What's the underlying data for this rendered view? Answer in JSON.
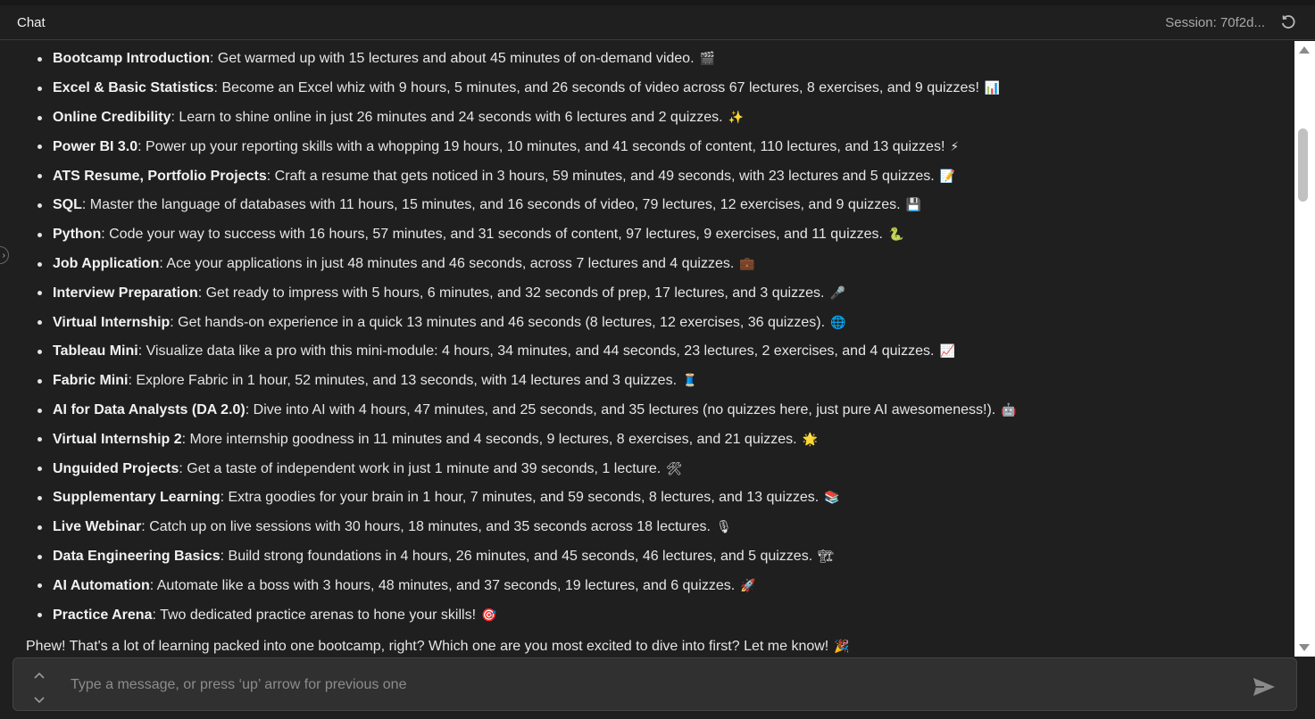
{
  "header": {
    "title": "Chat",
    "session": "Session: 70f2d..."
  },
  "messages": {
    "items": [
      {
        "name": "Bootcamp Introduction",
        "text": ": Get warmed up with 15 lectures and about 45 minutes of on-demand video.",
        "emoji": "🎬"
      },
      {
        "name": "Excel & Basic Statistics",
        "text": ": Become an Excel whiz with 9 hours, 5 minutes, and 26 seconds of video across 67 lectures, 8 exercises, and 9 quizzes!",
        "emoji": "📊"
      },
      {
        "name": "Online Credibility",
        "text": ": Learn to shine online in just 26 minutes and 24 seconds with 6 lectures and 2 quizzes.",
        "emoji": "✨"
      },
      {
        "name": "Power BI 3.0",
        "text": ": Power up your reporting skills with a whopping 19 hours, 10 minutes, and 41 seconds of content, 110 lectures, and 13 quizzes!",
        "emoji": "⚡"
      },
      {
        "name": "ATS Resume, Portfolio Projects",
        "text": ": Craft a resume that gets noticed in 3 hours, 59 minutes, and 49 seconds, with 23 lectures and 5 quizzes.",
        "emoji": "📝"
      },
      {
        "name": "SQL",
        "text": ": Master the language of databases with 11 hours, 15 minutes, and 16 seconds of video, 79 lectures, 12 exercises, and 9 quizzes.",
        "emoji": "💾"
      },
      {
        "name": "Python",
        "text": ": Code your way to success with 16 hours, 57 minutes, and 31 seconds of content, 97 lectures, 9 exercises, and 11 quizzes.",
        "emoji": "🐍"
      },
      {
        "name": "Job Application",
        "text": ": Ace your applications in just 48 minutes and 46 seconds, across 7 lectures and 4 quizzes.",
        "emoji": "💼"
      },
      {
        "name": "Interview Preparation",
        "text": ": Get ready to impress with 5 hours, 6 minutes, and 32 seconds of prep, 17 lectures, and 3 quizzes.",
        "emoji": "🎤"
      },
      {
        "name": "Virtual Internship",
        "text": ": Get hands-on experience in a quick 13 minutes and 46 seconds (8 lectures, 12 exercises, 36 quizzes).",
        "emoji": "🌐"
      },
      {
        "name": "Tableau Mini",
        "text": ": Visualize data like a pro with this mini-module: 4 hours, 34 minutes, and 44 seconds, 23 lectures, 2 exercises, and 4 quizzes.",
        "emoji": "📈"
      },
      {
        "name": "Fabric Mini",
        "text": ": Explore Fabric in 1 hour, 52 minutes, and 13 seconds, with 14 lectures and 3 quizzes.",
        "emoji": "🧵"
      },
      {
        "name": "AI for Data Analysts (DA 2.0)",
        "text": ": Dive into AI with 4 hours, 47 minutes, and 25 seconds, and 35 lectures (no quizzes here, just pure AI awesomeness!).",
        "emoji": "🤖"
      },
      {
        "name": "Virtual Internship 2",
        "text": ": More internship goodness in 11 minutes and 4 seconds, 9 lectures, 8 exercises, and 21 quizzes.",
        "emoji": "🌟"
      },
      {
        "name": "Unguided Projects",
        "text": ": Get a taste of independent work in just 1 minute and 39 seconds, 1 lecture.",
        "emoji": "🛠"
      },
      {
        "name": "Supplementary Learning",
        "text": ": Extra goodies for your brain in 1 hour, 7 minutes, and 59 seconds, 8 lectures, and 13 quizzes.",
        "emoji": "📚"
      },
      {
        "name": "Live Webinar",
        "text": ": Catch up on live sessions with 30 hours, 18 minutes, and 35 seconds across 18 lectures.",
        "emoji": "🎙"
      },
      {
        "name": "Data Engineering Basics",
        "text": ": Build strong foundations in 4 hours, 26 minutes, and 45 seconds, 46 lectures, and 5 quizzes.",
        "emoji": "🏗"
      },
      {
        "name": "AI Automation",
        "text": ": Automate like a boss with 3 hours, 48 minutes, and 37 seconds, 19 lectures, and 6 quizzes.",
        "emoji": "🚀"
      },
      {
        "name": "Practice Arena",
        "text": ": Two dedicated practice arenas to hone your skills!",
        "emoji": "🎯"
      }
    ],
    "closing": "Phew! That's a lot of learning packed into one bootcamp, right? Which one are you most excited to dive into first? Let me know!",
    "closing_emoji": "🎉"
  },
  "input": {
    "placeholder": "Type a message, or press ‘up’ arrow for previous one"
  },
  "icons": {
    "refresh": "refresh-icon",
    "send": "send-icon",
    "history_up": "chevron-up-icon",
    "history_down": "chevron-down-icon"
  }
}
